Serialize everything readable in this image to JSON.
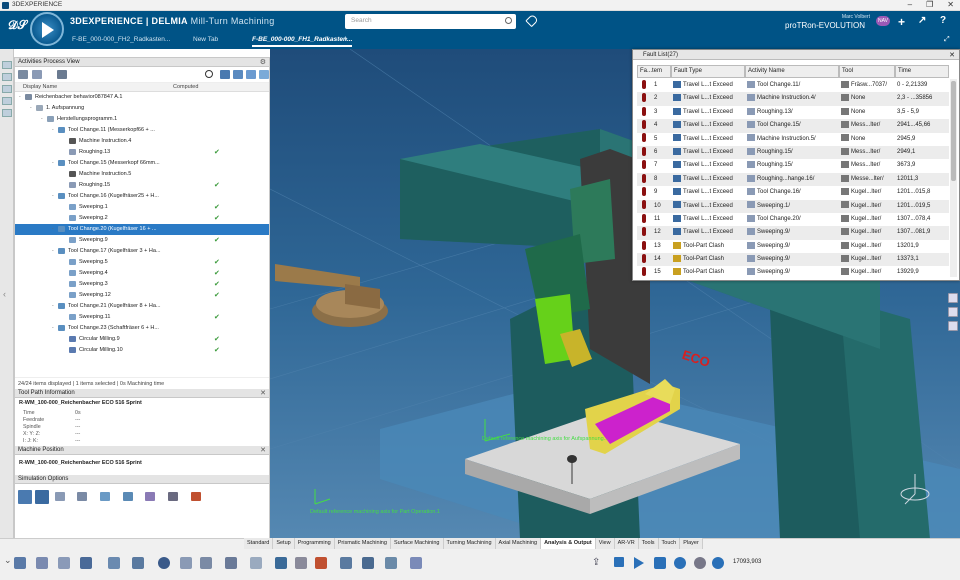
{
  "window": {
    "title": "3DEXPERIENCE"
  },
  "header": {
    "brand_bold": "3D",
    "brand": "EXPERIENCE | DELMIA",
    "app": "Mill-Turn Machining",
    "search_placeholder": "Search",
    "user_name": "Marc Volbert",
    "role": "proTRon-EVOLUTION",
    "nav_badge": "NAV"
  },
  "doc_tabs": [
    {
      "label": "F-BE_000-000_FH2_Radkasten..."
    },
    {
      "label": "New Tab"
    },
    {
      "label": "F-BE_000-000_FH1_Radkasten..."
    }
  ],
  "activities": {
    "title": "Activities Process View",
    "col_display": "Display Name",
    "col_computed": "Computed",
    "rows": [
      {
        "label": "Reichenbacher behavior087847 A.1",
        "indent": 0,
        "exp": "-",
        "computed": false,
        "icon": "machine-icon",
        "color": "#7a8aa0"
      },
      {
        "label": "1. Aufspannung",
        "indent": 1,
        "exp": "-",
        "computed": false,
        "icon": "setup-icon",
        "color": "#9aa8b8"
      },
      {
        "label": "Herstellungsprogramm.1",
        "indent": 2,
        "exp": "-",
        "computed": false,
        "icon": "program-icon",
        "color": "#8aa0b8"
      },
      {
        "label": "Tool Change.11 (Messerkopf66 + ...",
        "indent": 3,
        "exp": "-",
        "computed": false,
        "icon": "tool-change-icon",
        "color": "#5a8fc0"
      },
      {
        "label": "Machine Instruction.4",
        "indent": 4,
        "exp": "",
        "computed": false,
        "icon": "instruction-icon",
        "color": "#555"
      },
      {
        "label": "Roughing.13",
        "indent": 4,
        "exp": "",
        "computed": true,
        "icon": "roughing-icon",
        "color": "#8a9ab5"
      },
      {
        "label": "Tool Change.15 (Messerkopf 66mm...",
        "indent": 3,
        "exp": "-",
        "computed": false,
        "icon": "tool-change-icon",
        "color": "#5a8fc0"
      },
      {
        "label": "Machine Instruction.5",
        "indent": 4,
        "exp": "",
        "computed": false,
        "icon": "instruction-icon",
        "color": "#555"
      },
      {
        "label": "Roughing.15",
        "indent": 4,
        "exp": "",
        "computed": true,
        "icon": "roughing-icon",
        "color": "#8a9ab5"
      },
      {
        "label": "Tool Change.16 (Kugelfräser25 + H...",
        "indent": 3,
        "exp": "-",
        "computed": false,
        "icon": "tool-change-icon",
        "color": "#5a8fc0"
      },
      {
        "label": "Sweeping.1",
        "indent": 4,
        "exp": "",
        "computed": true,
        "icon": "sweeping-icon",
        "color": "#7aa0c8"
      },
      {
        "label": "Sweeping.2",
        "indent": 4,
        "exp": "",
        "computed": true,
        "icon": "sweeping-icon",
        "color": "#7aa0c8"
      },
      {
        "label": "Tool Change.20 (Kugelfräser 16 + ...",
        "indent": 3,
        "exp": "-",
        "computed": false,
        "icon": "tool-change-icon",
        "color": "#5a8fc0",
        "selected": true
      },
      {
        "label": "Sweeping.9",
        "indent": 4,
        "exp": "",
        "computed": true,
        "icon": "sweeping-icon",
        "color": "#7aa0c8"
      },
      {
        "label": "Tool Change.17 (Kugelfräser 3 + Ha...",
        "indent": 3,
        "exp": "-",
        "computed": false,
        "icon": "tool-change-icon",
        "color": "#5a8fc0"
      },
      {
        "label": "Sweeping.5",
        "indent": 4,
        "exp": "",
        "computed": true,
        "icon": "sweeping-icon",
        "color": "#7aa0c8"
      },
      {
        "label": "Sweeping.4",
        "indent": 4,
        "exp": "",
        "computed": true,
        "icon": "sweeping-icon",
        "color": "#7aa0c8"
      },
      {
        "label": "Sweeping.3",
        "indent": 4,
        "exp": "",
        "computed": true,
        "icon": "sweeping-icon",
        "color": "#7aa0c8"
      },
      {
        "label": "Sweeping.12",
        "indent": 4,
        "exp": "",
        "computed": true,
        "icon": "sweeping-icon",
        "color": "#7aa0c8"
      },
      {
        "label": "Tool Change.21 (Kugelfräser 8 + Ha...",
        "indent": 3,
        "exp": "-",
        "computed": false,
        "icon": "tool-change-icon",
        "color": "#5a8fc0"
      },
      {
        "label": "Sweeping.11",
        "indent": 4,
        "exp": "",
        "computed": true,
        "icon": "sweeping-icon",
        "color": "#7aa0c8"
      },
      {
        "label": "Tool Change.23 (Schaftfräser 6 + H...",
        "indent": 3,
        "exp": "-",
        "computed": false,
        "icon": "tool-change-icon",
        "color": "#5a8fc0"
      },
      {
        "label": "Circular Milling.9",
        "indent": 4,
        "exp": "",
        "computed": true,
        "icon": "circular-milling-icon",
        "color": "#5a7ab0"
      },
      {
        "label": "Circular Milling.10",
        "indent": 4,
        "exp": "",
        "computed": true,
        "icon": "circular-milling-icon",
        "color": "#5a7ab0"
      }
    ],
    "status": "24/24 items displayed | 1 items selected | 0s Machining time"
  },
  "toolpath": {
    "title": "Tool Path Information",
    "name": "R-WM_100-000_Reichenbacher ECO 516 Sprint",
    "fields": [
      {
        "k": "Time",
        "v": "0s"
      },
      {
        "k": "Feedrate",
        "v": "---"
      },
      {
        "k": "Spindle",
        "v": "---"
      },
      {
        "k": "X: Y: Z:",
        "v": "---"
      },
      {
        "k": "I: J: K:",
        "v": "---"
      }
    ]
  },
  "machine_position": {
    "title": "Machine Position",
    "name": "R-WM_100-000_Reichenbacher ECO 516 Sprint"
  },
  "sim_options": {
    "title": "Simulation Options"
  },
  "fault": {
    "title": "Fault List(27)",
    "columns": [
      "Fa...tem",
      "Fault Type",
      "Activity Name",
      "Tool",
      "Time"
    ],
    "rows": [
      [
        "1",
        "Travel L...t Exceed",
        "Tool Change.11/",
        "Fräsw...7037/",
        "0 - 2,21339"
      ],
      [
        "2",
        "Travel L...t Exceed",
        "Machine Instruction.4/",
        "None",
        "2,3 - ...35856"
      ],
      [
        "3",
        "Travel L...t Exceed",
        "Roughing.13/",
        "None",
        "3,5 - 5,9"
      ],
      [
        "4",
        "Travel L...t Exceed",
        "Tool Change.15/",
        "Mess...lter/",
        "2941...45,66"
      ],
      [
        "5",
        "Travel L...t Exceed",
        "Machine Instruction.5/",
        "None",
        "2945,9"
      ],
      [
        "6",
        "Travel L...t Exceed",
        "Roughing.15/",
        "Mess...lter/",
        "2949,1"
      ],
      [
        "7",
        "Travel L...t Exceed",
        "Roughing.15/",
        "Mess...lter/",
        "3673,9"
      ],
      [
        "8",
        "Travel L...t Exceed",
        "Roughing...hange.16/",
        "Messe...lter/",
        "12011,3"
      ],
      [
        "9",
        "Travel L...t Exceed",
        "Tool Change.16/",
        "Kugel...lter/",
        "1201...015,8"
      ],
      [
        "10",
        "Travel L...t Exceed",
        "Sweeping.1/",
        "Kugel...lter/",
        "1201...019,5"
      ],
      [
        "11",
        "Travel L...t Exceed",
        "Tool Change.20/",
        "Kugel...lter/",
        "1307...078,4"
      ],
      [
        "12",
        "Travel L...t Exceed",
        "Sweeping.9/",
        "Kugel...lter/",
        "1307...081,9"
      ],
      [
        "13",
        "Tool-Part Clash",
        "Sweeping.9/",
        "Kugel...lter/",
        "13201,9"
      ],
      [
        "14",
        "Tool-Part Clash",
        "Sweeping.9/",
        "Kugel...lter/",
        "13373,1"
      ],
      [
        "15",
        "Tool-Part Clash",
        "Sweeping.9/",
        "Kugel...lter/",
        "13929,9"
      ]
    ]
  },
  "viewport": {
    "machine_label": "ECO",
    "annotation1": "Default reference machining axis for Aufspannung...",
    "annotation2": "Default reference machining axis for Part Operation.1"
  },
  "workbench_tabs": [
    "Standard",
    "Setup",
    "Programming",
    "Prismatic Machining",
    "Surface Machining",
    "Turning Machining",
    "Axial Machining",
    "Analysis & Output",
    "View",
    "AR-VR",
    "Tools",
    "Touch",
    "Player"
  ],
  "active_workbench": "Analysis & Output",
  "player": {
    "time": "17093,903"
  }
}
